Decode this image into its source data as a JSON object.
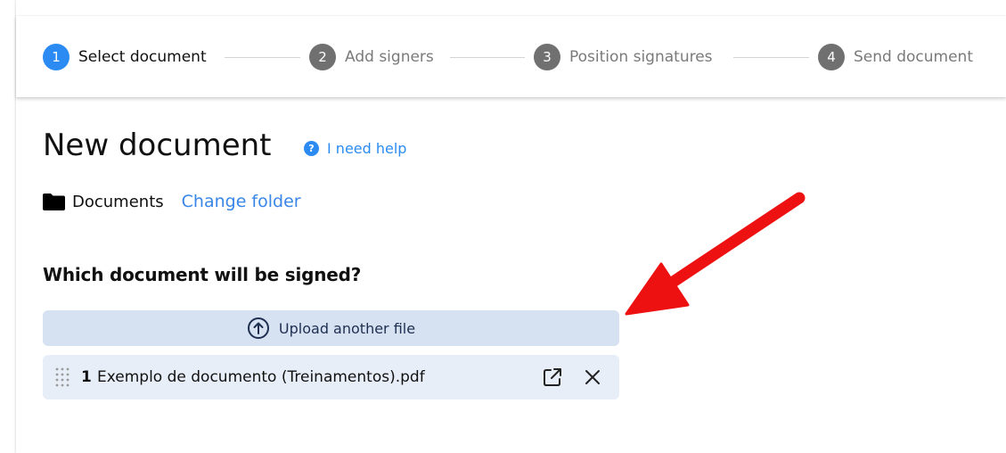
{
  "stepper": {
    "steps": [
      {
        "number": "1",
        "label": "Select document",
        "state": "active"
      },
      {
        "number": "2",
        "label": "Add signers",
        "state": "inactive"
      },
      {
        "number": "3",
        "label": "Position signatures",
        "state": "inactive"
      },
      {
        "number": "4",
        "label": "Send document",
        "state": "inactive"
      }
    ]
  },
  "page": {
    "title": "New document",
    "help_label": "I need help",
    "help_icon": "question-circle-icon"
  },
  "folder": {
    "icon": "folder-icon",
    "name": "Documents",
    "change_label": "Change folder"
  },
  "document_section": {
    "question": "Which document will be signed?",
    "upload_label": "Upload another file",
    "upload_icon": "arrow-up-circle-icon",
    "files": [
      {
        "index": "1",
        "name": "Exemplo de documento (Treinamentos).pdf"
      }
    ]
  },
  "annotation": {
    "type": "red-arrow",
    "color": "#ee1111"
  },
  "colors": {
    "accent": "#2b8bf2",
    "link": "#3a86e8",
    "upload_bg": "#d6e2f2",
    "file_row_bg": "#e8eef8"
  }
}
